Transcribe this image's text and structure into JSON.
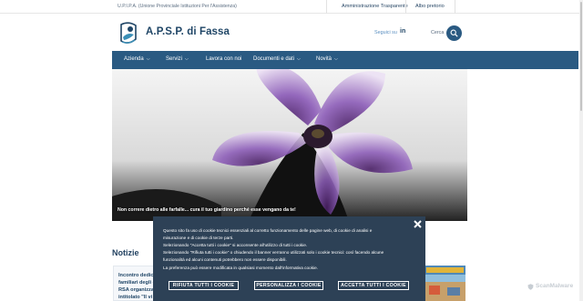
{
  "topbar": {
    "org_full_name": "U.P.I.P.A. (Unione Provinciale Istituzioni Per l'Assistenza)",
    "links": [
      "Amministrazione Trasparente",
      "Albo pretorio"
    ]
  },
  "header": {
    "brand": "A.P.S.P. di Fassa",
    "follow_label": "Seguici su",
    "linkedin_icon": "in",
    "search_label": "Cerca"
  },
  "nav": {
    "items": [
      {
        "label": "Azienda",
        "has_menu": true
      },
      {
        "label": "Servizi",
        "has_menu": true
      },
      {
        "label": "Lavora con noi",
        "has_menu": false
      },
      {
        "label": "Documenti e dati",
        "has_menu": true
      },
      {
        "label": "Novità",
        "has_menu": true
      }
    ]
  },
  "hero": {
    "caption": "Non correre dietro alle farfalle... cura il tuo giardino perché esse vengano da te!"
  },
  "news": {
    "heading": "Notizie",
    "card_lines": [
      "Incontro dedicato",
      "familiari degli o",
      "RSA organizzat",
      "intitolato \"Il vi"
    ]
  },
  "cookie_banner": {
    "lines": [
      "Questo sito fa uso di cookie tecnici essenziali al corretto funzionamento delle pagine web, di cookie di analisi e",
      "misurazione e di cookie di terze parti.",
      "Selezionando \"Accetta tutti i cookie\" si acconsente all'utilizzo di tutti i cookie.",
      "Selezionando \"Rifiuta tutti i cookie\" o chiudendo il banner verranno utilizzati solo i cookie tecnici: così facendo alcune",
      "funzionalità ed alcuni contenuti potrebbero non essere disponibili.",
      "La preferenza può essere modificata in qualsiasi momento dall'informativa cookie."
    ],
    "buttons": {
      "reject": "RIFIUTA TUTTI I COOKIE",
      "customize": "PERSONALIZZA I COOKIE",
      "accept": "ACCETTA TUTTI I COOKIE"
    }
  },
  "watermark": "ScanMalware",
  "colors": {
    "primary": "#2a5a82",
    "banner_bg": "#2d4156",
    "brand_text": "#1f4566"
  }
}
